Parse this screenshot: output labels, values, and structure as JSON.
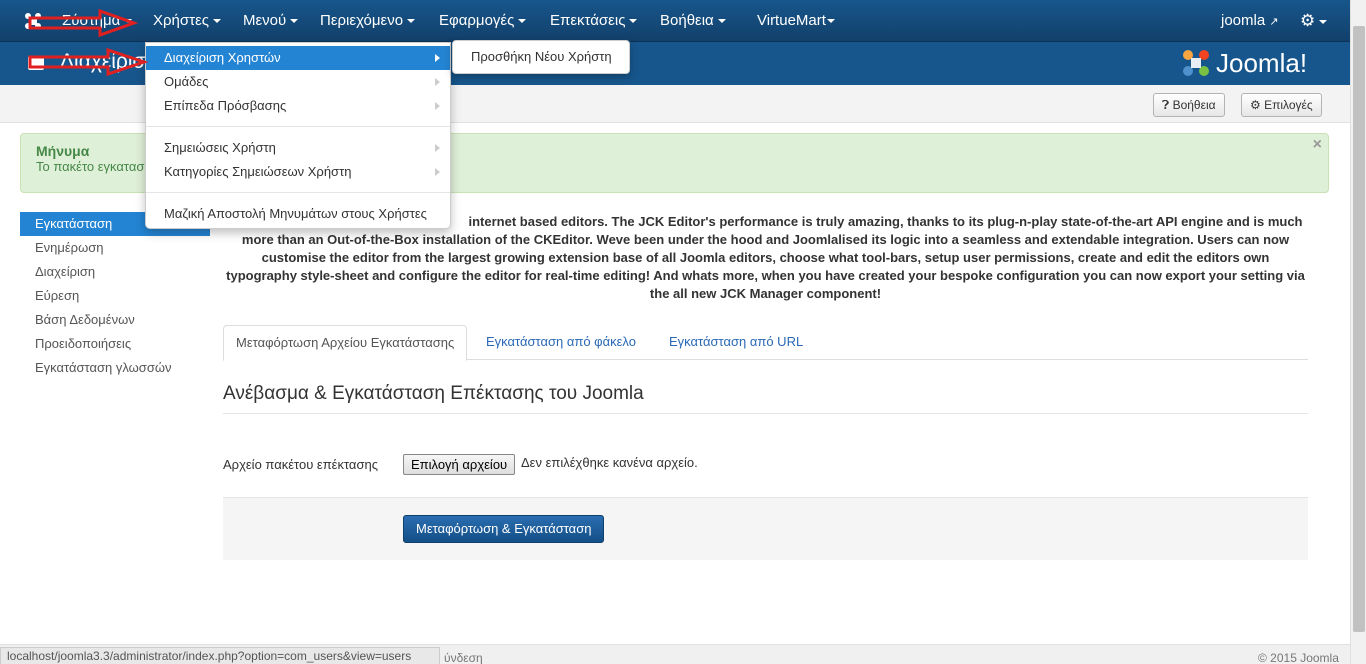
{
  "navbar": {
    "items": [
      {
        "label": "Σύστημα"
      },
      {
        "label": "Χρήστες"
      },
      {
        "label": "Μενού"
      },
      {
        "label": "Περιεχόμενο"
      },
      {
        "label": "Εφαρμογές"
      },
      {
        "label": "Επεκτάσεις"
      },
      {
        "label": "Βοήθεια"
      },
      {
        "label": "VirtueMart"
      }
    ],
    "user": "joomla"
  },
  "subhead": {
    "title": "Διαχείριση",
    "brand": "Joomla!"
  },
  "toolbar": {
    "help": "Βοήθεια",
    "options": "Επιλογές"
  },
  "alert": {
    "heading": "Μήνυμα",
    "message": "Το πακέτο εγκατασ",
    "close": "×"
  },
  "sidebar": {
    "items": [
      {
        "label": "Εγκατάσταση"
      },
      {
        "label": "Ενημέρωση"
      },
      {
        "label": "Διαχείριση"
      },
      {
        "label": "Εύρεση"
      },
      {
        "label": "Βάση Δεδομένων"
      },
      {
        "label": "Προειδοποιήσεις"
      },
      {
        "label": "Εγκατάσταση γλωσσών"
      }
    ]
  },
  "description": {
    "line1": "internet based editors. The JCK Editor's performance is truly amazing, thanks to its plug-n-play state-of-the-art API engine and is much",
    "line2": "more than an Out-of-the-Box installation of the CKEditor. Weve been under the hood and Joomlalised its logic into a seamless and extendable integration. Users can now",
    "line3": "customise the editor from the largest growing extension base of all Joomla editors, choose what tool-bars, setup user permissions, create and edit the editors own",
    "line4": "typography style-sheet and configure the editor for real-time editing! And whats more, when you have created your bespoke configuration you can now export your setting via",
    "line5": "the all new JCK Manager component!"
  },
  "tabs": [
    {
      "label": "Μεταφόρτωση Αρχείου Εγκατάστασης"
    },
    {
      "label": "Εγκατάσταση από φάκελο"
    },
    {
      "label": "Εγκατάσταση από URL"
    }
  ],
  "upload": {
    "heading": "Ανέβασμα & Εγκατάσταση Επέκτασης του Joomla",
    "field_label": "Αρχείο πακέτου επέκτασης",
    "file_button": "Επιλογή αρχείου",
    "no_file": "Δεν επιλέχθηκε κανένα αρχείο.",
    "submit": "Μεταφόρτωση & Εγκατάσταση"
  },
  "dropdown": {
    "items": [
      {
        "label": "Διαχείριση Χρηστών"
      },
      {
        "label": "Ομάδες"
      },
      {
        "label": "Επίπεδα Πρόσβασης"
      },
      {
        "label": "Σημειώσεις Χρήστη"
      },
      {
        "label": "Κατηγορίες Σημειώσεων Χρήστη"
      },
      {
        "label": "Μαζική Αποστολή Μηνυμάτων στους Χρήστες"
      }
    ],
    "submenu": "Προσθήκη Νέου Χρήστη"
  },
  "status": {
    "url": "localhost/joomla3.3/administrator/index.php?option=com_users&view=users",
    "footer": "ύνδεση",
    "copyright": "© 2015 Joomla"
  },
  "colors": {
    "navbar": "#17568c",
    "accent": "#2384d3",
    "annotation": "#e02020"
  }
}
